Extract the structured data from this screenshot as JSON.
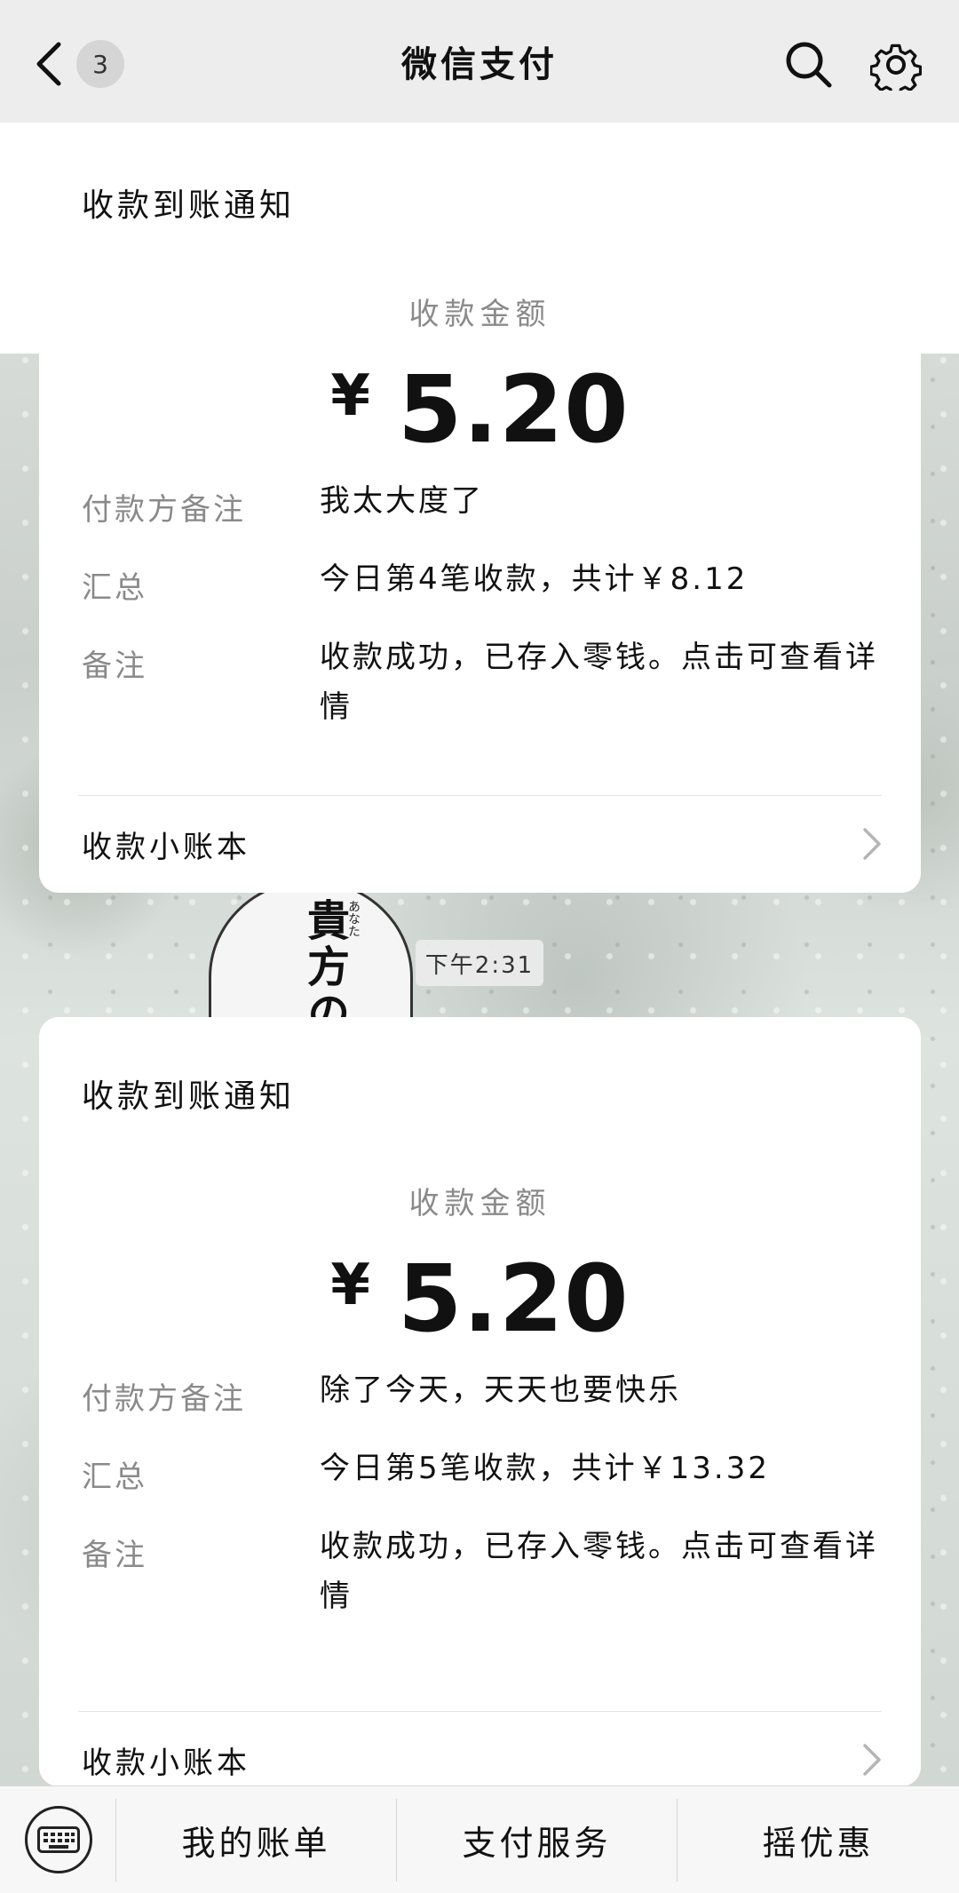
{
  "header": {
    "title": "微信支付",
    "unread_count": "3"
  },
  "cards": [
    {
      "title": "收款到账通知",
      "amount_label": "收款金额",
      "currency": "¥",
      "amount": "5.20",
      "payer_note_key": "付款方备注",
      "payer_note_value": "我太大度了",
      "summary_key": "汇总",
      "summary_value": "今日第4笔收款，共计￥8.12",
      "remark_key": "备注",
      "remark_value": "收款成功，已存入零钱。点击可查看详情",
      "ledger_label": "收款小账本"
    },
    {
      "title": "收款到账通知",
      "amount_label": "收款金额",
      "currency": "¥",
      "amount": "5.20",
      "payer_note_key": "付款方备注",
      "payer_note_value": "除了今天，天天也要快乐",
      "summary_key": "汇总",
      "summary_value": "今日第5笔收款，共计￥13.32",
      "remark_key": "备注",
      "remark_value": "收款成功，已存入零钱。点击可查看详情",
      "ledger_label": "收款小账本"
    }
  ],
  "timestamp": "下午2:31",
  "background_art": {
    "bubble_text": "貴方の",
    "bubble_ruby": "あなた"
  },
  "bottom_menu": {
    "item1": "我的账单",
    "item2": "支付服务",
    "item3": "摇优惠"
  },
  "icons": {
    "back": "chevron-left-icon",
    "search": "search-icon",
    "settings": "gear-icon",
    "keyboard": "keyboard-icon",
    "disclosure": "chevron-right-icon"
  }
}
